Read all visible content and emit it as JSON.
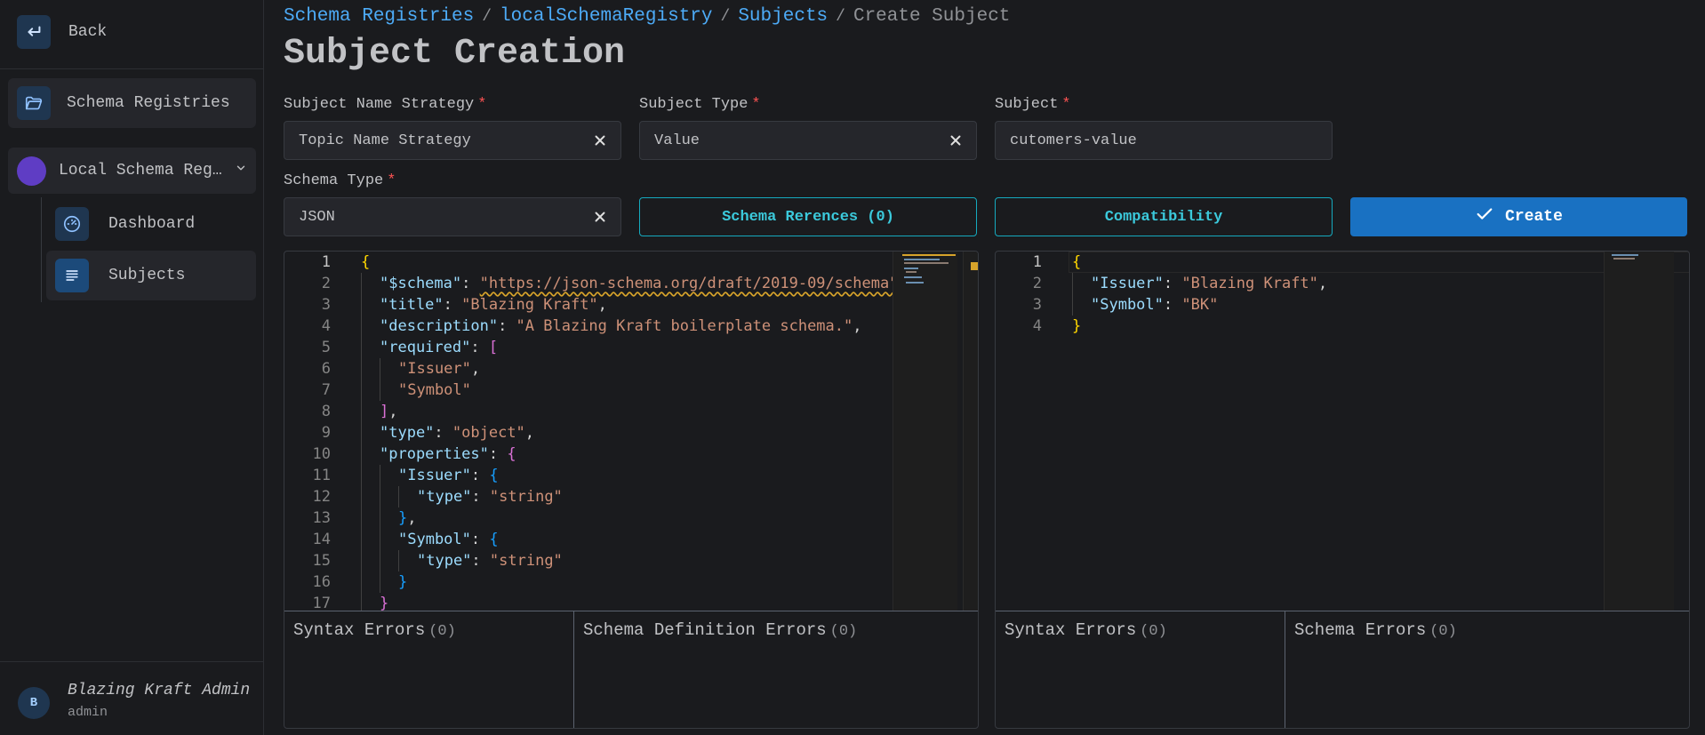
{
  "sidebar": {
    "back_label": "Back",
    "schema_registries_label": "Schema Registries",
    "registry_label": "Local Schema Registry",
    "dashboard_label": "Dashboard",
    "subjects_label": "Subjects",
    "user_initial": "B",
    "user_name": "Blazing Kraft Admin",
    "user_role": "admin"
  },
  "breadcrumb": {
    "items": [
      "Schema Registries",
      "localSchemaRegistry",
      "Subjects"
    ],
    "current": "Create Subject"
  },
  "page_title": "Subject Creation",
  "form": {
    "subject_name_strategy": {
      "label": "Subject Name Strategy",
      "required": "*",
      "value": "Topic Name Strategy"
    },
    "subject_type": {
      "label": "Subject Type",
      "required": "*",
      "value": "Value"
    },
    "subject": {
      "label": "Subject",
      "required": "*",
      "value": "cutomers-value"
    },
    "schema_type": {
      "label": "Schema Type",
      "required": "*",
      "value": "JSON"
    }
  },
  "buttons": {
    "schema_references": "Schema Rerences (0)",
    "compatibility": "Compatibility",
    "create": "Create"
  },
  "schema_editor": {
    "line_numbers": [
      "1",
      "2",
      "3",
      "4",
      "5",
      "6",
      "7",
      "8",
      "9",
      "10",
      "11",
      "12",
      "13",
      "14",
      "15",
      "16",
      "17"
    ]
  },
  "example_editor": {
    "line_numbers": [
      "1",
      "2",
      "3",
      "4"
    ]
  },
  "errors": {
    "left_syntax": "Syntax Errors",
    "left_syntax_count": "(0)",
    "left_definition": "Schema Definition Errors",
    "left_definition_count": "(0)",
    "right_syntax": "Syntax Errors",
    "right_syntax_count": "(0)",
    "right_schema": "Schema Errors",
    "right_schema_count": "(0)"
  },
  "colors": {
    "accent": "#4dabf7",
    "create_button": "#1971c2",
    "outline_button": "#15aabf",
    "required": "#fa5252",
    "registry_dot": "#5f3dc4"
  },
  "icons": [
    "back-arrow-icon",
    "folder-icon",
    "chevron-down-icon",
    "dashboard-gauge-icon",
    "list-icon",
    "close-icon",
    "check-icon"
  ]
}
